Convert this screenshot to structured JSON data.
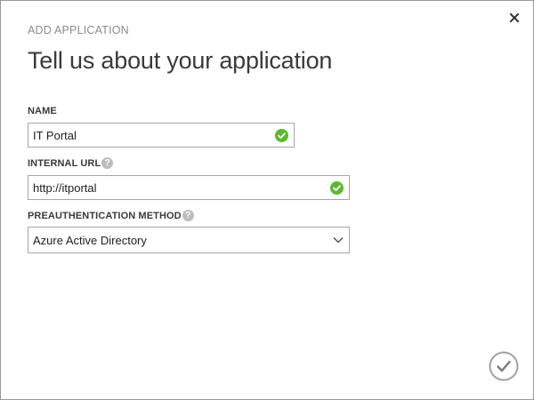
{
  "dialog": {
    "eyebrow": "ADD APPLICATION",
    "title": "Tell us about your application"
  },
  "fields": {
    "name": {
      "label": "NAME",
      "value": "IT Portal",
      "status_icon": "checkmark-circle-icon"
    },
    "internal_url": {
      "label": "INTERNAL URL",
      "help_glyph": "?",
      "value": "http://itportal",
      "status_icon": "checkmark-circle-icon"
    },
    "preauth_method": {
      "label": "PREAUTHENTICATION METHOD",
      "help_glyph": "?",
      "selected": "Azure Active Directory"
    }
  },
  "icons": {
    "close": "close-icon",
    "confirm": "checkmark-circle-icon",
    "dropdown": "chevron-down-icon",
    "help": "question-icon"
  },
  "colors": {
    "valid_green": "#5cb82e",
    "border": "#a6a6a6",
    "eyebrow_gray": "#8c8c8c"
  }
}
